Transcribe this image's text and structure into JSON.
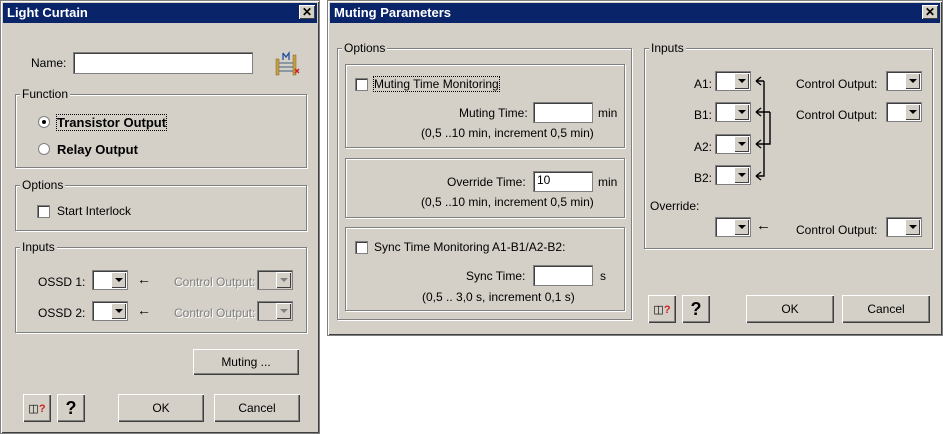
{
  "left_dialog": {
    "title": "Light Curtain",
    "close_glyph": "✕",
    "name_label": "Name:",
    "name_value": "",
    "function_group": "Function",
    "transistor_output": "Transistor Output",
    "relay_output": "Relay Output",
    "options_group": "Options",
    "start_interlock": "Start Interlock",
    "inputs_group": "Inputs",
    "ossd1": "OSSD 1:",
    "ossd2": "OSSD 2:",
    "control_output_1": "Control Output:",
    "control_output_2": "Control Output:",
    "muting_button": "Muting ...",
    "help_icon_glyph": "?",
    "question_glyph": "?",
    "ok_button": "OK",
    "cancel_button": "Cancel"
  },
  "right_dialog": {
    "title": "Muting Parameters",
    "close_glyph": "✕",
    "options_group": "Options",
    "muting_time_monitoring": "Muting Time Monitoring",
    "muting_time_label": "Muting Time:",
    "muting_time_value": "",
    "muting_time_unit": "min",
    "muting_time_range": "(0,5 ..10 min, increment 0,5 min)",
    "override_time_label": "Override Time:",
    "override_time_value": "10",
    "override_time_unit": "min",
    "override_time_range": "(0,5 ..10 min, increment 0,5 min)",
    "sync_time_monitoring": "Sync Time Monitoring A1-B1/A2-B2:",
    "sync_time_label": "Sync Time:",
    "sync_time_value": "",
    "sync_time_unit": "s",
    "sync_time_range": "(0,5 .. 3,0 s, increment 0,1 s)",
    "inputs_group": "Inputs",
    "a1": "A1:",
    "b1": "B1:",
    "a2": "A2:",
    "b2": "B2:",
    "override": "Override:",
    "control_output_a1": "Control Output:",
    "control_output_b1": "Control Output:",
    "control_output_override": "Control Output:",
    "help_icon_glyph": "?",
    "question_glyph": "?",
    "ok_button": "OK",
    "cancel_button": "Cancel"
  }
}
